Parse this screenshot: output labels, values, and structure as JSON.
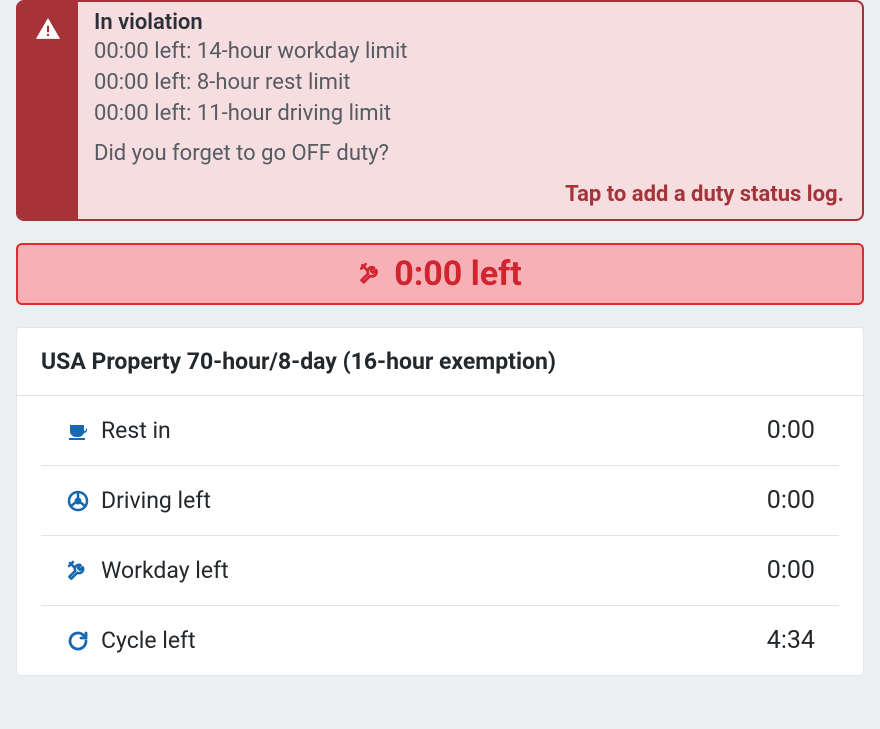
{
  "alert": {
    "title": "In violation",
    "lines": [
      "00:00 left: 14-hour workday limit",
      "00:00 left: 8-hour rest limit",
      "00:00 left: 11-hour driving limit"
    ],
    "question": "Did you forget to go OFF duty?",
    "cta": "Tap to add a duty status log."
  },
  "banner": {
    "text": "0:00 left"
  },
  "status": {
    "header": "USA Property 70-hour/8-day (16-hour exemption)",
    "rows": [
      {
        "icon": "cup",
        "label": "Rest in",
        "value": "0:00",
        "color": "#1668b0"
      },
      {
        "icon": "wheel",
        "label": "Driving left",
        "value": "0:00",
        "color": "#1668b0"
      },
      {
        "icon": "tools",
        "label": "Workday left",
        "value": "0:00",
        "color": "#1668b0"
      },
      {
        "icon": "refresh",
        "label": "Cycle left",
        "value": "4:34",
        "color": "#1668b0"
      }
    ]
  }
}
